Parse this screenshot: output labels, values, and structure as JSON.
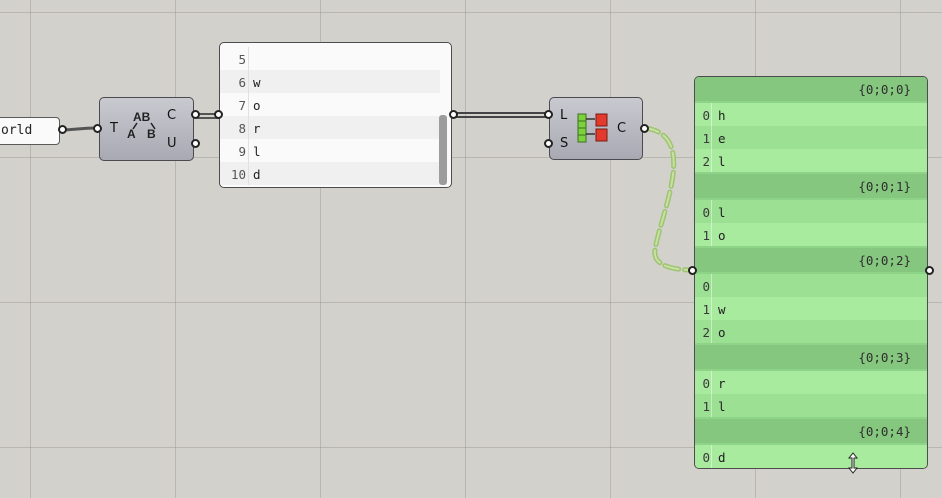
{
  "text_panel": {
    "value": "orld"
  },
  "replace_component": {
    "inputs": [
      {
        "label": "T"
      }
    ],
    "outputs": [
      {
        "label": "C"
      },
      {
        "label": "U"
      }
    ],
    "icon_text": {
      "top": "AB",
      "bottom_left": "A",
      "bottom_right": "B"
    },
    "icon_name": "split-characters-icon"
  },
  "list_panel": {
    "rows": [
      {
        "index": "5",
        "value": ""
      },
      {
        "index": "6",
        "value": "w"
      },
      {
        "index": "7",
        "value": "o"
      },
      {
        "index": "8",
        "value": "r"
      },
      {
        "index": "9",
        "value": "l"
      },
      {
        "index": "10",
        "value": "d"
      }
    ]
  },
  "partition_component": {
    "inputs": [
      {
        "label": "L"
      },
      {
        "label": "S"
      }
    ],
    "outputs": [
      {
        "label": "C"
      }
    ],
    "icon_name": "partition-list-icon"
  },
  "tree_panel": {
    "branches": [
      {
        "path": "{0;0;0}",
        "items": [
          {
            "index": "0",
            "value": "h"
          },
          {
            "index": "1",
            "value": "e"
          },
          {
            "index": "2",
            "value": "l"
          }
        ]
      },
      {
        "path": "{0;0;1}",
        "items": [
          {
            "index": "0",
            "value": "l"
          },
          {
            "index": "1",
            "value": "o"
          }
        ]
      },
      {
        "path": "{0;0;2}",
        "items": [
          {
            "index": "0",
            "value": ""
          },
          {
            "index": "1",
            "value": "w"
          },
          {
            "index": "2",
            "value": "o"
          }
        ]
      },
      {
        "path": "{0;0;3}",
        "items": [
          {
            "index": "0",
            "value": "r"
          },
          {
            "index": "1",
            "value": "l"
          }
        ]
      },
      {
        "path": "{0;0;4}",
        "items": [
          {
            "index": "0",
            "value": "d"
          }
        ]
      }
    ]
  },
  "colors": {
    "canvas": "#d3d1cb",
    "component": "#b5b5bd",
    "tree_panel": "#8ed488",
    "dashed_wire": "#a8c97d"
  }
}
